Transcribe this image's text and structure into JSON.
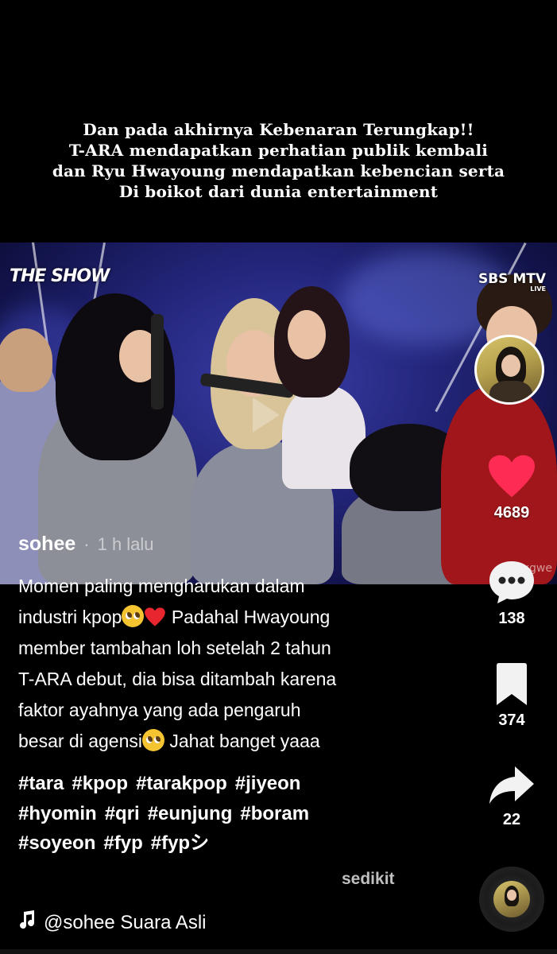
{
  "overlay_caption": {
    "line1": "Dan pada akhirnya Kebenaran Terungkap!!",
    "line2": "T-ARA mendapatkan perhatian publik kembali",
    "line3": "dan Ryu Hwayoung mendapatkan kebencian serta",
    "line4": "Di boikot dari dunia entertainment"
  },
  "video": {
    "logo_left": "THE SHOW",
    "logo_right": "SBS MTV",
    "logo_right_sub": "LIVE",
    "watermark": "@xgwe"
  },
  "post": {
    "username": "sohee",
    "time_ago": "1 h lalu",
    "description_lines": [
      "Momen paling mengharukan dalam",
      "industri kpop",
      "Padahal Hwayoung",
      "member tambahan loh setelah 2 tahun",
      "T-ARA debut, dia bisa ditambah karena",
      "faktor ayahnya yang ada pengaruh",
      "besar di agensi",
      "Jahat banget yaaa"
    ],
    "hashtags": [
      "#tara",
      "#kpop",
      "#tarakpop",
      "#jiyeon",
      "#hyomin",
      "#qri",
      "#eunjung",
      "#boram",
      "#soyeon",
      "#fyp",
      "#fypシ"
    ],
    "see_more": "sedikit",
    "sound": "@sohee Suara Asli"
  },
  "actions": {
    "likes": "4689",
    "comments": "138",
    "bookmarks": "374",
    "shares": "22"
  },
  "icons": {
    "like": "heart-icon",
    "comment": "comment-bubble-icon",
    "bookmark": "bookmark-icon",
    "share": "share-arrow-icon",
    "sound": "music-note-icon"
  },
  "colors": {
    "like_red": "#fe2c55",
    "background": "#000000"
  }
}
